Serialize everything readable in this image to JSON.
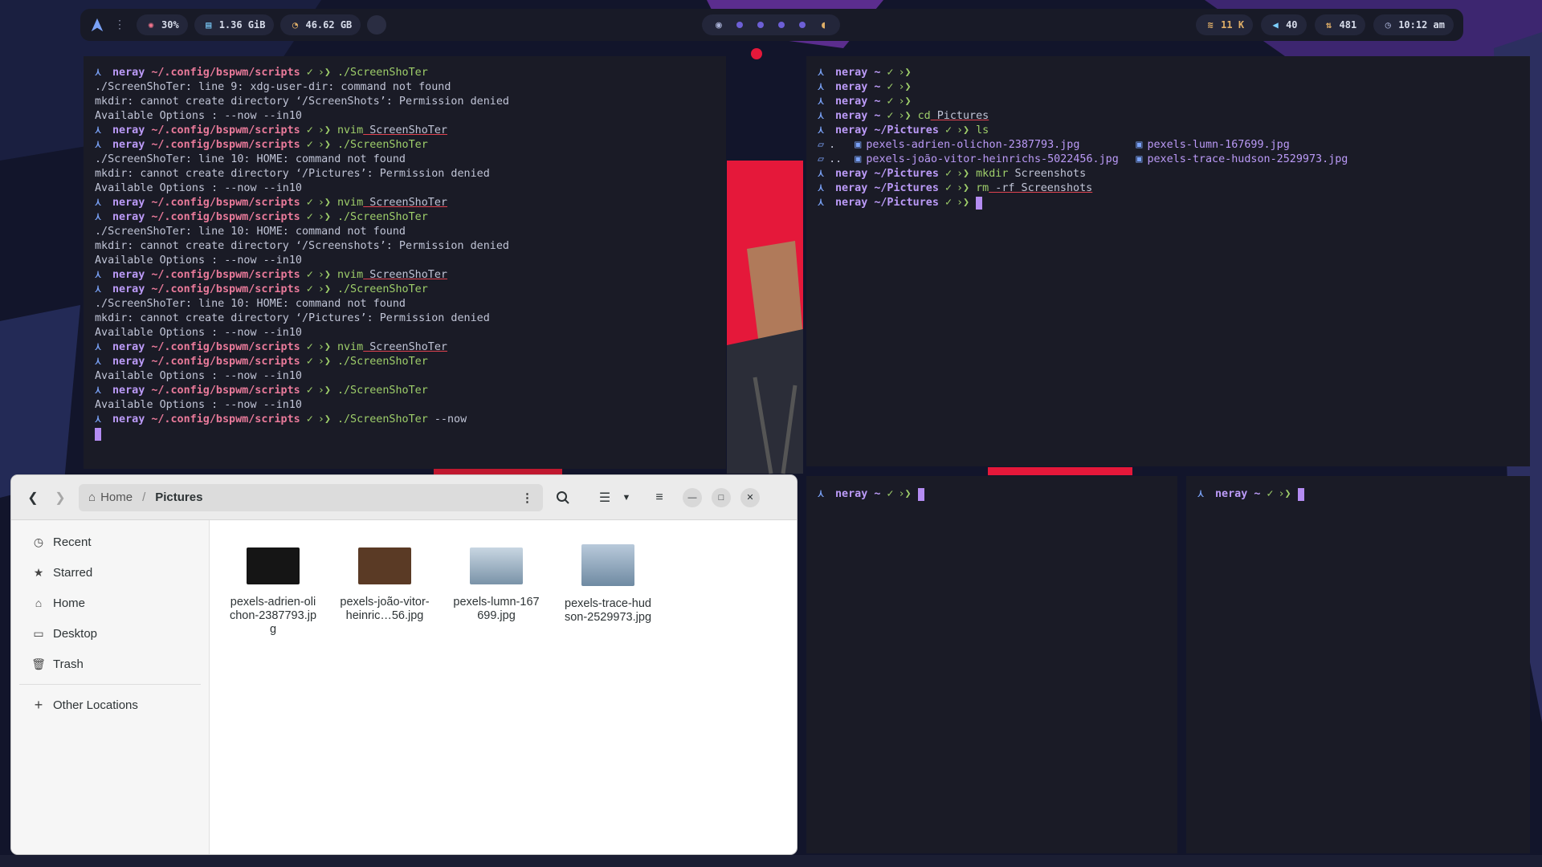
{
  "colors": {
    "accent_purple": "#bb9af7",
    "prompt_path": "#e97a9a",
    "command_green": "#9ece6a",
    "arch_blue": "#7aa2f7",
    "terminal_bg": "#1a1b26",
    "cursor": "#b48cf2"
  },
  "topbar": {
    "logo_icon": "arch-linux-icon",
    "menu_icon": "vertical-dots-icon",
    "cpu": "30%",
    "memory": "1.36 GiB",
    "disk": "46.62 GB",
    "workspaces": [
      "ghost-icon",
      "dot",
      "dot",
      "dot",
      "dot",
      "pacman-icon"
    ],
    "wifi": "11 K",
    "volume": "40",
    "updates": "481",
    "time": "10:12 am"
  },
  "term1": {
    "lines": [
      {
        "type": "prompt",
        "user": "neray",
        "path": "~/.config/bspwm/scripts",
        "cmd": "./ScreenShoTer",
        "args": ""
      },
      {
        "type": "out",
        "text": "./ScreenShoTer: line 9: xdg-user-dir: command not found"
      },
      {
        "type": "out",
        "text": "mkdir: cannot create directory ‘/ScreenShots’: Permission denied"
      },
      {
        "type": "out",
        "text": "Available Options : --now --in10"
      },
      {
        "type": "prompt",
        "user": "neray",
        "path": "~/.config/bspwm/scripts",
        "cmd": "nvim",
        "args": "ScreenShoTer"
      },
      {
        "type": "prompt",
        "user": "neray",
        "path": "~/.config/bspwm/scripts",
        "cmd": "./ScreenShoTer",
        "args": ""
      },
      {
        "type": "out",
        "text": "./ScreenShoTer: line 10: HOME: command not found"
      },
      {
        "type": "out",
        "text": "mkdir: cannot create directory ‘/Pictures’: Permission denied"
      },
      {
        "type": "out",
        "text": "Available Options : --now --in10"
      },
      {
        "type": "prompt",
        "user": "neray",
        "path": "~/.config/bspwm/scripts",
        "cmd": "nvim",
        "args": "ScreenShoTer"
      },
      {
        "type": "prompt",
        "user": "neray",
        "path": "~/.config/bspwm/scripts",
        "cmd": "./ScreenShoTer",
        "args": ""
      },
      {
        "type": "out",
        "text": "./ScreenShoTer: line 10: HOME: command not found"
      },
      {
        "type": "out",
        "text": "mkdir: cannot create directory ‘/Screenshots’: Permission denied"
      },
      {
        "type": "out",
        "text": "Available Options : --now --in10"
      },
      {
        "type": "prompt",
        "user": "neray",
        "path": "~/.config/bspwm/scripts",
        "cmd": "nvim",
        "args": "ScreenShoTer"
      },
      {
        "type": "prompt",
        "user": "neray",
        "path": "~/.config/bspwm/scripts",
        "cmd": "./ScreenShoTer",
        "args": ""
      },
      {
        "type": "out",
        "text": "./ScreenShoTer: line 10: HOME: command not found"
      },
      {
        "type": "out",
        "text": "mkdir: cannot create directory ‘/Pictures’: Permission denied"
      },
      {
        "type": "out",
        "text": "Available Options : --now --in10"
      },
      {
        "type": "prompt",
        "user": "neray",
        "path": "~/.config/bspwm/scripts",
        "cmd": "nvim",
        "args": "ScreenShoTer"
      },
      {
        "type": "prompt",
        "user": "neray",
        "path": "~/.config/bspwm/scripts",
        "cmd": "./ScreenShoTer",
        "args": ""
      },
      {
        "type": "out",
        "text": "Available Options : --now --in10"
      },
      {
        "type": "prompt",
        "user": "neray",
        "path": "~/.config/bspwm/scripts",
        "cmd": "./ScreenShoTer",
        "args": ""
      },
      {
        "type": "out",
        "text": "Available Options : --now --in10"
      },
      {
        "type": "prompt",
        "user": "neray",
        "path": "~/.config/bspwm/scripts",
        "cmd": "./ScreenShoTer",
        "args": "--now"
      }
    ]
  },
  "term2": {
    "lines": [
      {
        "type": "prompt",
        "user": "neray",
        "path": "~",
        "cmd": "",
        "args": ""
      },
      {
        "type": "prompt",
        "user": "neray",
        "path": "~",
        "cmd": "",
        "args": ""
      },
      {
        "type": "prompt",
        "user": "neray",
        "path": "~",
        "cmd": "",
        "args": ""
      },
      {
        "type": "prompt",
        "user": "neray",
        "path": "~",
        "cmd": "cd",
        "args": "Pictures"
      },
      {
        "type": "prompt",
        "user": "neray",
        "path": "~/Pictures",
        "cmd": "ls",
        "args": ""
      },
      {
        "type": "ls",
        "dir": ".",
        "file1": "pexels-adrien-olichon-2387793.jpg",
        "file2": "pexels-lumn-167699.jpg"
      },
      {
        "type": "ls",
        "dir": "..",
        "file1": "pexels-joão-vitor-heinrichs-5022456.jpg",
        "file2": "pexels-trace-hudson-2529973.jpg"
      },
      {
        "type": "prompt",
        "user": "neray",
        "path": "~/Pictures",
        "cmd": "mkdir",
        "args": "Screenshots"
      },
      {
        "type": "prompt",
        "user": "neray",
        "path": "~/Pictures",
        "cmd": "rm",
        "args": "-rf Screenshots"
      },
      {
        "type": "prompt",
        "user": "neray",
        "path": "~/Pictures",
        "cmd": "",
        "args": ""
      }
    ]
  },
  "term3": {
    "user": "neray",
    "path": "~"
  },
  "term4": {
    "user": "neray",
    "path": "~"
  },
  "filemanager": {
    "breadcrumb_home": "Home",
    "breadcrumb_current": "Pictures",
    "sidebar": [
      {
        "label": "Recent",
        "icon": "clock-icon"
      },
      {
        "label": "Starred",
        "icon": "star-icon"
      },
      {
        "label": "Home",
        "icon": "home-icon"
      },
      {
        "label": "Desktop",
        "icon": "folder-icon"
      },
      {
        "label": "Trash",
        "icon": "trash-icon"
      }
    ],
    "other_locations": "Other Locations",
    "files": [
      {
        "name": "pexels-adrien-olichon-2387793.jpg",
        "color": "#151515"
      },
      {
        "name": "pexels-joão-vitor-heinric…56.jpg",
        "color": "#5a3a25"
      },
      {
        "name": "pexels-lumn-167699.jpg",
        "color": "#9fb3c4"
      },
      {
        "name": "pexels-trace-hudson-2529973.jpg",
        "color": "#8ea7bd"
      }
    ]
  }
}
